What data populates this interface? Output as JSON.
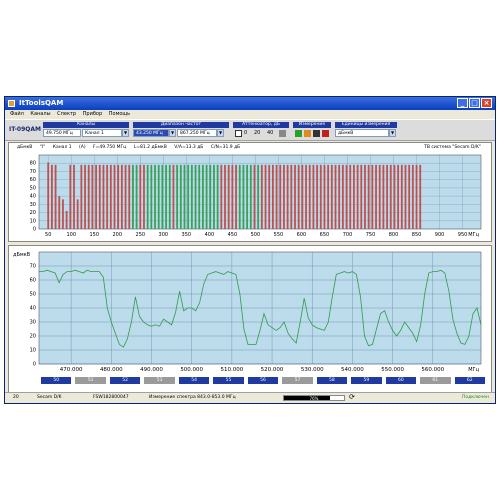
{
  "window": {
    "title": "ItToolsQAM"
  },
  "menu": [
    "Файл",
    "Каналы",
    "Спектр",
    "Прибор",
    "Помощь"
  ],
  "toolbar": {
    "product": "IT-09QAM",
    "channels_header": "Каналы",
    "channel_freq": "49.750 МГц",
    "channel_name": "Канал 1",
    "range_header": "Диапазон частот",
    "range_from": "43.250 МГц",
    "range_to": "867.250 МГц",
    "attenuator_header": "Аттенюатор, дБ",
    "attenuator_values": [
      "0",
      "20",
      "40"
    ],
    "measure_header": "Измерение",
    "units_header": "Единицы измерения",
    "units_value": "дБмкВ"
  },
  "spectrum_panel": {
    "unit_label": "дБмкВ",
    "marker_code": "\"I\"",
    "info_channel": "Канал 1",
    "info_mod": "(A)",
    "info_freq": "F=49.750 МГц",
    "info_level": "L=81.2 дБмкВ",
    "info_va": "V/A=13.3 дБ",
    "info_cn": "C/N=31.9 дБ",
    "tv_system": "ТВ система \"Secam D/K\"",
    "x_unit": "МГц"
  },
  "detail_panel": {
    "unit_label": "дБмкВ",
    "x_unit": "МГц"
  },
  "channel_strip": [
    {
      "label": "50",
      "active": true
    },
    {
      "label": "51",
      "active": false
    },
    {
      "label": "52",
      "active": true
    },
    {
      "label": "53",
      "active": false
    },
    {
      "label": "54",
      "active": true
    },
    {
      "label": "55",
      "active": true
    },
    {
      "label": "56",
      "active": true
    },
    {
      "label": "57",
      "active": false
    },
    {
      "label": "58",
      "active": true
    },
    {
      "label": "59",
      "active": true
    },
    {
      "label": "60",
      "active": true
    },
    {
      "label": "61",
      "active": false
    },
    {
      "label": "62",
      "active": true
    }
  ],
  "status": {
    "num": "20",
    "system": "Secam D/K",
    "serial": "FSW182800047",
    "task": "Измерение спектра 843.0-853.0 МГц",
    "progress": 0.76,
    "progress_text": "76%",
    "connection": "Подключен"
  },
  "colors": {
    "title_blue": "#0a3fc0",
    "header_blue": "#1f3aa0",
    "plot_bg": "#bcdcec",
    "analog_bar": "#c0504d",
    "digital_bar": "#3aa05a",
    "trace": "#2f9a4a",
    "connected": "#1a8a1a"
  },
  "chart_data": [
    {
      "type": "bar",
      "title": "",
      "ylabel": "дБмкВ",
      "xlabel": "МГц",
      "xlim": [
        30,
        990
      ],
      "ylim": [
        0,
        90
      ],
      "x_ticks": [
        50,
        100,
        150,
        200,
        250,
        300,
        350,
        400,
        450,
        500,
        550,
        600,
        650,
        700,
        750,
        800,
        850,
        900,
        950
      ],
      "y_ticks": [
        0,
        10,
        20,
        30,
        40,
        50,
        60,
        70,
        80
      ],
      "series": [
        {
          "name": "",
          "x": [
            50,
            58,
            66,
            74,
            82,
            90,
            98,
            106,
            114,
            122,
            130,
            138,
            146,
            154,
            162,
            170,
            178,
            186,
            194,
            202,
            210,
            218,
            226,
            234,
            242,
            250,
            258,
            266,
            274,
            282,
            290,
            298,
            306,
            314,
            322,
            330,
            338,
            346,
            354,
            362,
            370,
            378,
            386,
            394,
            402,
            410,
            418,
            426,
            434,
            442,
            450,
            458,
            466,
            474,
            482,
            490,
            498,
            506,
            514,
            522,
            530,
            538,
            546,
            554,
            562,
            570,
            578,
            586,
            594,
            602,
            610,
            618,
            626,
            634,
            642,
            650,
            658,
            666,
            674,
            682,
            690,
            698,
            706,
            714,
            722,
            730,
            738,
            746,
            754,
            762,
            770,
            778,
            786,
            794,
            802,
            810,
            818,
            826,
            834,
            842,
            850,
            858
          ],
          "values": [
            81,
            78,
            78,
            40,
            36,
            22,
            78,
            78,
            36,
            78,
            78,
            78,
            78,
            78,
            78,
            78,
            78,
            78,
            78,
            78,
            78,
            78,
            78,
            78,
            78,
            78,
            78,
            78,
            78,
            78,
            78,
            78,
            78,
            78,
            78,
            78,
            78,
            78,
            78,
            78,
            78,
            78,
            78,
            78,
            78,
            78,
            78,
            78,
            78,
            78,
            78,
            78,
            78,
            78,
            78,
            78,
            78,
            78,
            78,
            78,
            78,
            78,
            78,
            78,
            78,
            78,
            78,
            78,
            78,
            78,
            78,
            78,
            78,
            78,
            78,
            78,
            78,
            78,
            78,
            78,
            78,
            78,
            78,
            78,
            78,
            78,
            78,
            78,
            78,
            78,
            78,
            78,
            78,
            78,
            78,
            78,
            78,
            78,
            78,
            78,
            78,
            78
          ],
          "kind": [
            "a",
            "a",
            "a",
            "a",
            "a",
            "a",
            "a",
            "a",
            "a",
            "a",
            "a",
            "a",
            "a",
            "a",
            "a",
            "a",
            "a",
            "a",
            "a",
            "a",
            "a",
            "a",
            "a",
            "d",
            "d",
            "a",
            "a",
            "d",
            "d",
            "d",
            "d",
            "d",
            "d",
            "d",
            "a",
            "d",
            "d",
            "d",
            "d",
            "d",
            "d",
            "d",
            "d",
            "d",
            "d",
            "d",
            "d",
            "a",
            "a",
            "a",
            "a",
            "a",
            "d",
            "d",
            "d",
            "d",
            "a",
            "d",
            "a",
            "a",
            "a",
            "a",
            "a",
            "a",
            "a",
            "a",
            "a",
            "a",
            "a",
            "a",
            "a",
            "a",
            "a",
            "a",
            "a",
            "a",
            "a",
            "a",
            "a",
            "a",
            "a",
            "a",
            "a",
            "a",
            "a",
            "a",
            "a",
            "a",
            "a",
            "a",
            "a",
            "a",
            "a",
            "a",
            "a",
            "a",
            "a",
            "a",
            "a",
            "a",
            "a",
            "a"
          ]
        }
      ]
    },
    {
      "type": "line",
      "title": "",
      "ylabel": "дБмкВ",
      "xlabel": "МГц",
      "xlim": [
        462,
        572
      ],
      "ylim": [
        0,
        80
      ],
      "x_ticks": [
        470,
        480,
        490,
        500,
        510,
        520,
        530,
        540,
        550,
        560
      ],
      "y_ticks": [
        0,
        10,
        20,
        30,
        40,
        50,
        60,
        70
      ],
      "series": [
        {
          "name": "",
          "x": [
            462,
            463,
            464,
            465,
            466,
            467,
            468,
            469,
            470,
            471,
            472,
            473,
            474,
            475,
            476,
            477,
            478,
            479,
            480,
            481,
            482,
            483,
            484,
            485,
            486,
            487,
            488,
            489,
            490,
            491,
            492,
            493,
            494,
            495,
            496,
            497,
            498,
            499,
            500,
            501,
            502,
            503,
            504,
            505,
            506,
            507,
            508,
            509,
            510,
            511,
            512,
            513,
            514,
            515,
            516,
            517,
            518,
            519,
            520,
            521,
            522,
            523,
            524,
            525,
            526,
            527,
            528,
            529,
            530,
            531,
            532,
            533,
            534,
            535,
            536,
            537,
            538,
            539,
            540,
            541,
            542,
            543,
            544,
            545,
            546,
            547,
            548,
            549,
            550,
            551,
            552,
            553,
            554,
            555,
            556,
            557,
            558,
            559,
            560,
            561,
            562,
            563,
            564,
            565,
            566,
            567,
            568,
            569,
            570,
            571,
            572
          ],
          "values": [
            66,
            66,
            67,
            66,
            65,
            58,
            64,
            66,
            66,
            67,
            66,
            65,
            67,
            66,
            66,
            66,
            62,
            40,
            30,
            22,
            14,
            12,
            18,
            30,
            48,
            34,
            30,
            28,
            27,
            28,
            27,
            32,
            30,
            28,
            37,
            52,
            38,
            40,
            40,
            38,
            44,
            57,
            64,
            65,
            66,
            65,
            64,
            66,
            65,
            64,
            50,
            25,
            14,
            14,
            14,
            24,
            36,
            28,
            26,
            24,
            26,
            30,
            22,
            18,
            15,
            30,
            47,
            33,
            28,
            26,
            25,
            24,
            30,
            48,
            64,
            65,
            66,
            65,
            66,
            64,
            48,
            20,
            13,
            14,
            25,
            36,
            38,
            30,
            24,
            20,
            24,
            30,
            26,
            22,
            16,
            28,
            50,
            65,
            66,
            66,
            67,
            65,
            52,
            32,
            22,
            15,
            14,
            20,
            36,
            40,
            28
          ]
        }
      ]
    }
  ]
}
